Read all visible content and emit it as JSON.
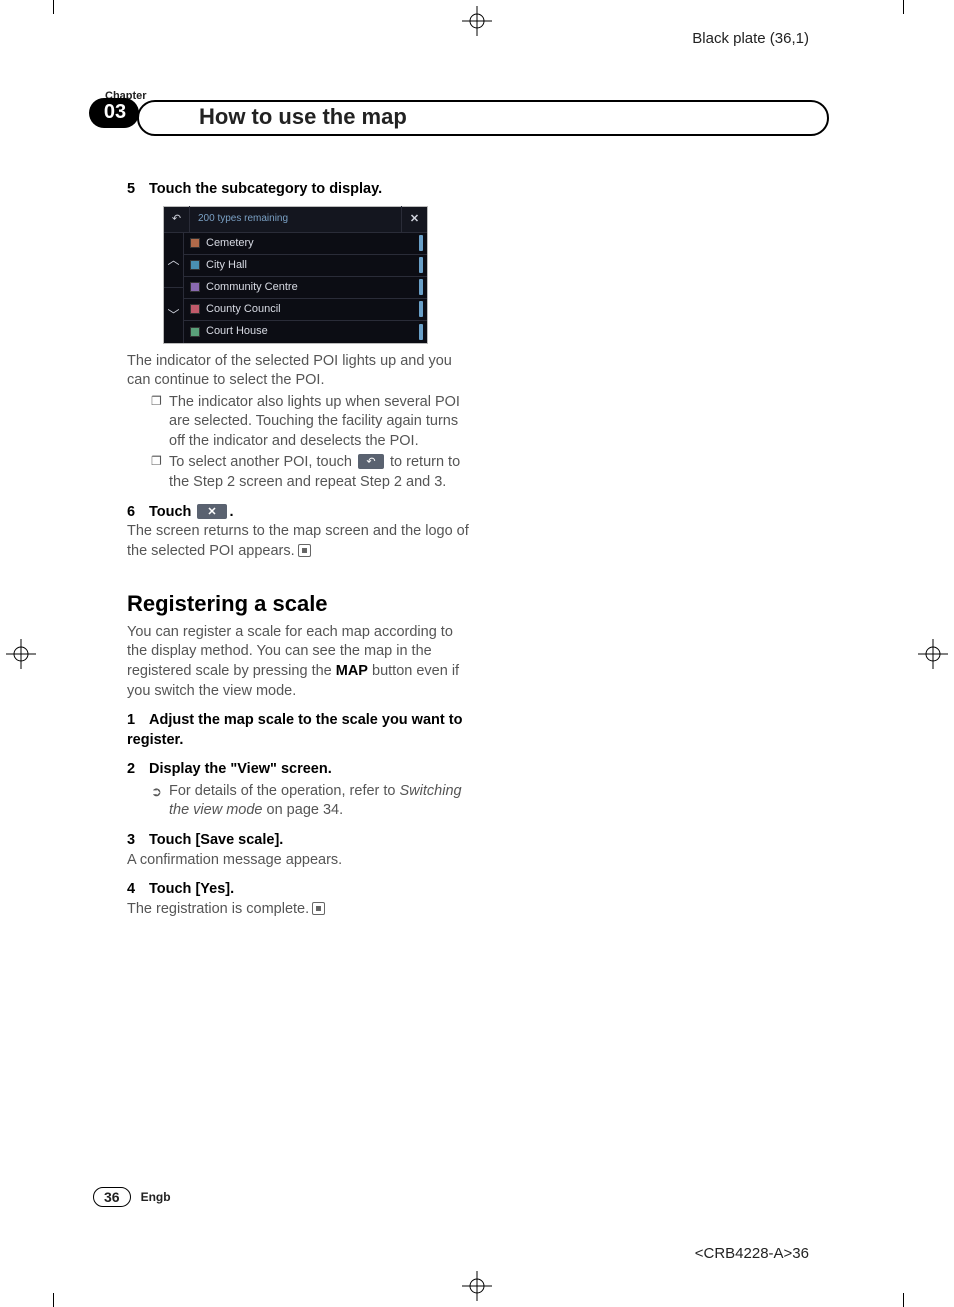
{
  "plate_label": "Black plate (36,1)",
  "doc_code": "<CRB4228-A>36",
  "chapter": {
    "label": "Chapter",
    "number": "03"
  },
  "title": "How to use the map",
  "shot": {
    "title": "200 types remaining",
    "items": [
      "Cemetery",
      "City Hall",
      "Community Centre",
      "County Council",
      "Court House"
    ]
  },
  "step5": {
    "num": "5",
    "title": "Touch the subcategory to display.",
    "p1": "The indicator of the selected POI lights up and you can continue to select the POI.",
    "b1": "The indicator also lights up when several POI are selected. Touching the facility again turns off the indicator and deselects the POI.",
    "b2a": "To select another POI, touch ",
    "b2b": " to return to the Step 2 screen and repeat Step 2 and 3."
  },
  "step6": {
    "num": "6",
    "title_a": "Touch ",
    "title_b": ".",
    "p1": "The screen returns to the map screen and the logo of the selected POI appears."
  },
  "h2": "Registering a scale",
  "reg_intro_a": "You can register a scale for each map according to the display method. You can see the map in the registered scale by pressing the ",
  "reg_intro_bold": "MAP",
  "reg_intro_b": " button even if you switch the view mode.",
  "reg_s1": {
    "num": "1",
    "title": "Adjust the map scale to the scale you want to register."
  },
  "reg_s2": {
    "num": "2",
    "title": "Display the \"View\" screen.",
    "detail_a": "For details of the operation, refer to ",
    "detail_i": "Switching the view mode",
    "detail_b": " on page 34."
  },
  "reg_s3": {
    "num": "3",
    "title": "Touch  [Save scale].",
    "p": "A confirmation message appears."
  },
  "reg_s4": {
    "num": "4",
    "title": "Touch [Yes].",
    "p": "The registration is complete."
  },
  "footer": {
    "page": "36",
    "lang": "Engb"
  }
}
